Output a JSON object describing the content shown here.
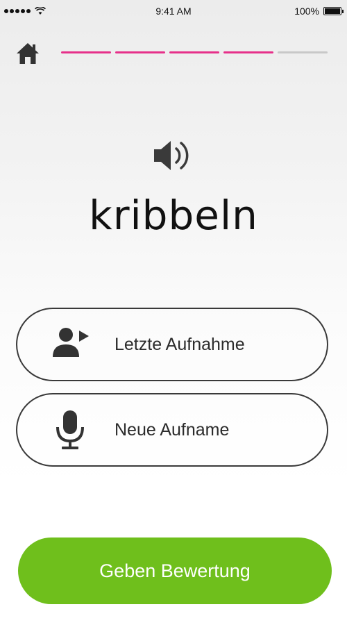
{
  "status_bar": {
    "time": "9:41 AM",
    "battery_text": "100%",
    "battery_level": 1.0,
    "signal_dots": 5,
    "icons": [
      "signal-dots-icon",
      "wifi-icon",
      "battery-icon"
    ]
  },
  "header": {
    "home_icon": "home-icon",
    "progress": {
      "segments_total": 5,
      "segments_done": 4,
      "done_color": "#e6308a",
      "todo_color": "#c8c8c8"
    }
  },
  "word": {
    "speaker_icon": "speaker-icon",
    "text": "kribbeln"
  },
  "actions": {
    "last_recording": {
      "label": "Letzte Aufnahme",
      "icon": "person-play-icon"
    },
    "new_recording": {
      "label": "Neue Aufname",
      "icon": "microphone-icon"
    }
  },
  "submit": {
    "label": "Geben Bewertung",
    "color": "#6fbf1c"
  }
}
